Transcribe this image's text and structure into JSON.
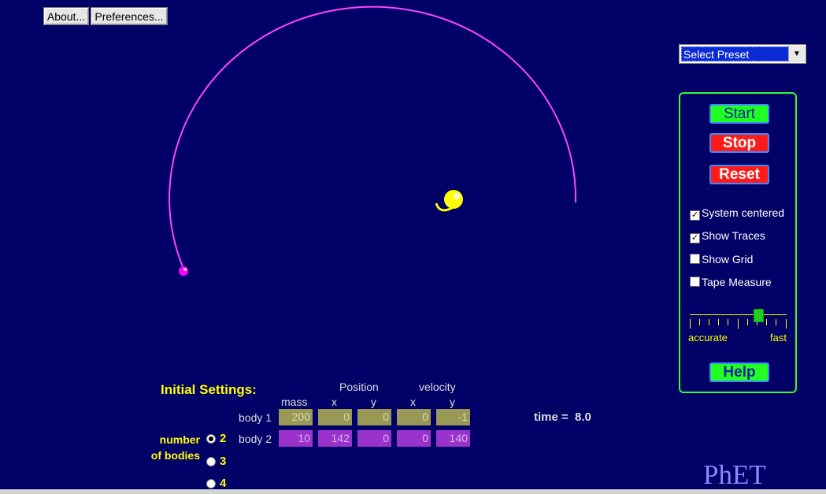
{
  "menu": {
    "about": "About...",
    "preferences": "Preferences..."
  },
  "preset": {
    "selected": "Select Preset"
  },
  "controls": {
    "start": "Start",
    "stop": "Stop",
    "reset": "Reset",
    "help": "Help"
  },
  "options": [
    {
      "label": "System centered",
      "checked": true
    },
    {
      "label": "Show Traces",
      "checked": true
    },
    {
      "label": "Show Grid",
      "checked": false
    },
    {
      "label": "Tape Measure",
      "checked": false
    }
  ],
  "speed": {
    "left_label": "accurate",
    "right_label": "fast"
  },
  "init": {
    "title": "Initial Settings:",
    "headers": {
      "mass": "mass",
      "position": "Position",
      "velocity": "velocity",
      "x": "x",
      "y": "y"
    },
    "bodies": [
      {
        "label": "body 1",
        "mass": "200",
        "x": "0",
        "y": "0",
        "vx": "0",
        "vy": "-1"
      },
      {
        "label": "body 2",
        "mass": "10",
        "x": "142",
        "y": "0",
        "vx": "0",
        "vy": "140"
      }
    ],
    "number_label_1": "number",
    "number_label_2": "of bodies",
    "choices": [
      "2",
      "3",
      "4"
    ],
    "selected": "2"
  },
  "time": {
    "label": "time =",
    "value": "8.0"
  },
  "logo": "PhET",
  "colors": {
    "background": "#000066",
    "sun": "#ffff00",
    "planet": "#ff00ff",
    "trace": "#ff44ff",
    "panel_border": "#33ff33"
  }
}
